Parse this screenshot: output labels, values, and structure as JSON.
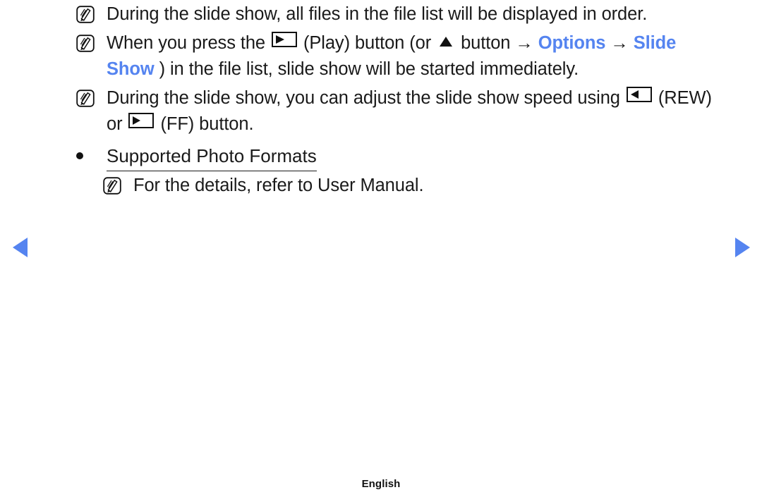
{
  "page": {
    "language_footer": "English",
    "accent_blue": "#5584f0",
    "text_color": "#1a1a1a"
  },
  "notes": [
    {
      "icon": "note-icon",
      "segments": [
        {
          "type": "text",
          "value": "During the slide show, all files in the file list will be displayed in order."
        }
      ],
      "plain": "During the slide show, all files in the file list will be displayed in order."
    },
    {
      "icon": "note-icon",
      "segments": [
        {
          "type": "text",
          "value": "When you press the "
        },
        {
          "type": "key",
          "value": "play-pause-key"
        },
        {
          "type": "text",
          "value": " (Play) button (or "
        },
        {
          "type": "key",
          "value": "triangle-up-key"
        },
        {
          "type": "text",
          "value": " button "
        },
        {
          "type": "arrow",
          "value": "→"
        },
        {
          "type": "link",
          "value": "Options"
        },
        {
          "type": "arrow",
          "value": "→"
        },
        {
          "type": "link",
          "value": "Slide Show"
        },
        {
          "type": "text",
          "value": ") in the file list, slide show will be started immediately."
        }
      ],
      "plain": "When you press the (Play) button (or button → Options → Slide Show) in the file list, slide show will be started immediately."
    },
    {
      "icon": "note-icon",
      "segments": [
        {
          "type": "text",
          "value": "During the slide show, you can adjust the slide show speed using "
        },
        {
          "type": "key",
          "value": "rewind-key"
        },
        {
          "type": "text",
          "value": " (REW) or "
        },
        {
          "type": "key",
          "value": "fastforward-key"
        },
        {
          "type": "text",
          "value": " (FF) button."
        }
      ],
      "plain": "During the slide show, you can adjust the slide show speed using (REW) or (FF) button."
    }
  ],
  "note_texts": {
    "n1": "During the slide show, all files in the file list will be displayed in order.",
    "n2_a": "When you press the",
    "n2_b": "(Play) button (or",
    "n2_c": "button",
    "n2_arrow1": "→",
    "n2_options": "Options",
    "n2_arrow2": "→",
    "n2_slideshow": "Slide Show",
    "n2_d": ") in the file list, slide show will be started immediately.",
    "n3_a": "During the slide show, you can adjust the slide show speed using",
    "n3_b": "(REW) or",
    "n3_c": "(FF) button.",
    "n4": "For the details, refer to User Manual."
  },
  "bullet": {
    "label": "Supported Photo Formats",
    "marker": "●"
  },
  "nav": {
    "prev_label": "previous-page",
    "next_label": "next-page",
    "prev_glyph": "◀",
    "next_glyph": "▶"
  },
  "icons": {
    "note": "note-pencil-icon",
    "play_pause": "play-pause-icon",
    "triangle_up": "triangle-up-icon",
    "rewind": "rewind-icon",
    "fast_forward": "fast-forward-icon"
  }
}
